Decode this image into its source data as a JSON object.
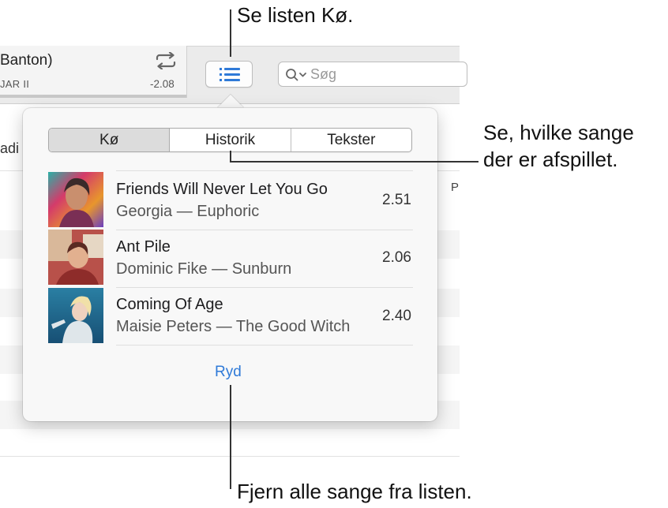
{
  "now_playing": {
    "title_fragment": "Banton)",
    "subtitle_fragment": "JAR II",
    "time_remaining": "-2.08"
  },
  "search": {
    "placeholder": "Søg"
  },
  "background_list": {
    "column_header_fragment": "adi",
    "column_p": "P"
  },
  "popover": {
    "tabs": [
      {
        "label": "Kø",
        "active": true
      },
      {
        "label": "Historik",
        "active": false
      },
      {
        "label": "Tekster",
        "active": false
      }
    ],
    "queue": [
      {
        "title": "Friends Will Never Let You Go",
        "artist_album": "Georgia — Euphoric",
        "duration": "2.51"
      },
      {
        "title": "Ant Pile",
        "artist_album": "Dominic Fike — Sunburn",
        "duration": "2.06"
      },
      {
        "title": "Coming Of Age",
        "artist_album": "Maisie Peters — The Good Witch",
        "duration": "2.40"
      }
    ],
    "clear_label": "Ryd"
  },
  "callouts": {
    "queue": "Se listen Kø.",
    "history_line1": "Se, hvilke sange",
    "history_line2": "der er afspillet.",
    "clear": "Fjern alle sange fra listen."
  },
  "colors": {
    "accent": "#2f7ad8"
  }
}
